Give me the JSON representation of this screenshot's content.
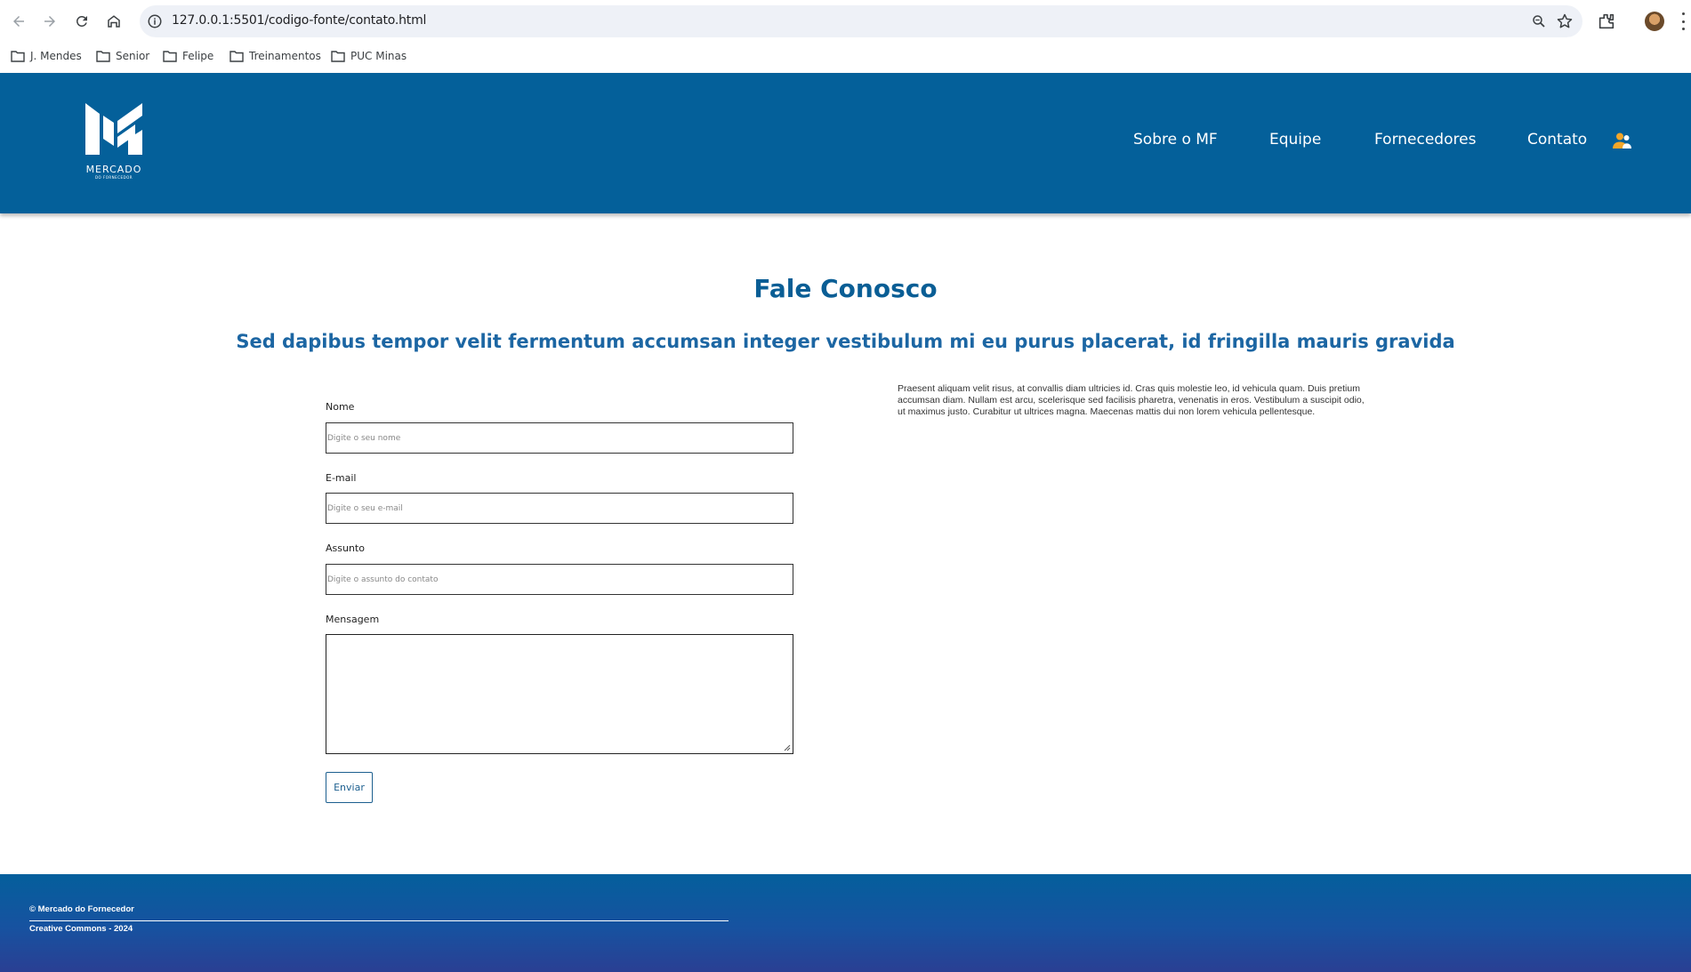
{
  "browser": {
    "url": "127.0.0.1:5501/codigo-fonte/contato.html",
    "bookmarks": [
      {
        "label": "J. Mendes"
      },
      {
        "label": "Senior"
      },
      {
        "label": "Felipe"
      },
      {
        "label": "Treinamentos"
      },
      {
        "label": "PUC Minas"
      }
    ],
    "icons": [
      "back-icon",
      "forward-icon",
      "reload-icon",
      "home-icon",
      "site-info-icon",
      "zoom-icon",
      "bookmark-star-icon",
      "extensions-icon",
      "profile-avatar",
      "menu-icon"
    ]
  },
  "header": {
    "logo_word": "MERCADO",
    "logo_sub": "DO FORNECEDOR",
    "nav": [
      {
        "label": "Sobre o MF"
      },
      {
        "label": "Equipe"
      },
      {
        "label": "Fornecedores"
      },
      {
        "label": "Contato"
      }
    ],
    "user_icon": "users-icon",
    "colors": {
      "header_bg": "#04609a",
      "user_icon": "#f3a629"
    }
  },
  "main": {
    "title": "Fale Conosco",
    "subtitle": "Sed dapibus tempor velit fermentum accumsan integer vestibulum mi eu purus placerat, id fringilla mauris gravida",
    "form": {
      "name_label": "Nome",
      "name_placeholder": "Digite o seu nome",
      "email_label": "E-mail",
      "email_placeholder": "Digite o seu e-mail",
      "subject_label": "Assunto",
      "subject_placeholder": "Digite o assunto do contato",
      "message_label": "Mensagem",
      "message_value": "",
      "submit_label": "Enviar"
    },
    "side_text": "Praesent aliquam velit risus, at convallis diam ultricies id. Cras quis molestie leo, id vehicula quam. Duis pretium accumsan diam. Nullam est arcu, scelerisque sed facilisis pharetra, venenatis in eros. Vestibulum a suscipit odio, ut maximus justo. Curabitur ut ultrices magna. Maecenas mattis dui non lorem vehicula pellentesque."
  },
  "footer": {
    "copyright": "© Mercado do Fornecedor",
    "license": "Creative Commons - 2024"
  }
}
